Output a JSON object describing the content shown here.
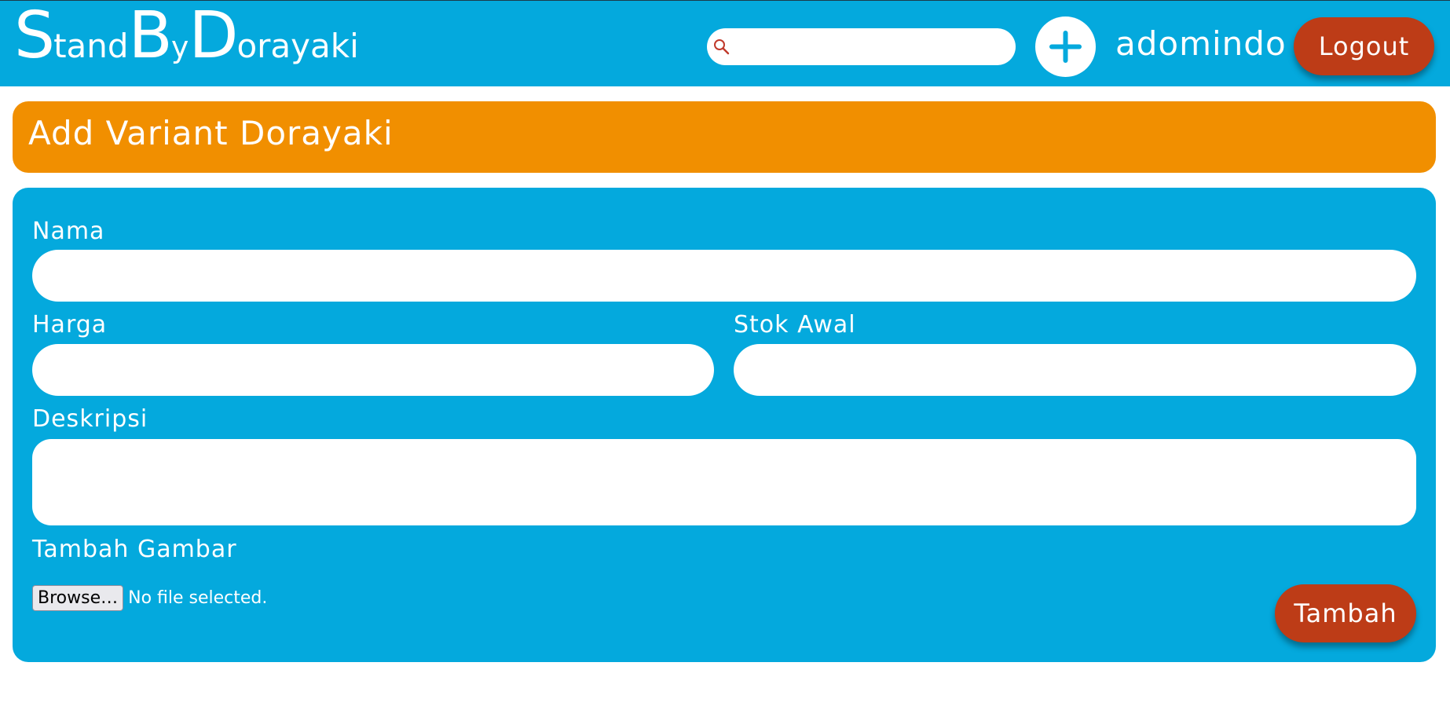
{
  "header": {
    "logo": {
      "s_cap": "S",
      "s_rest": "tand",
      "b_cap": "B",
      "b_rest": "y",
      "d_cap": "D",
      "d_rest": "orayaki"
    },
    "search": {
      "value": "",
      "placeholder": "",
      "icon": "magnifier-icon"
    },
    "add_button_icon": "plus-icon",
    "username": "adomindo",
    "logout_label": "Logout"
  },
  "page": {
    "title": "Add Variant Dorayaki"
  },
  "form": {
    "nama": {
      "label": "Nama",
      "value": ""
    },
    "harga": {
      "label": "Harga",
      "value": ""
    },
    "stok_awal": {
      "label": "Stok Awal",
      "value": ""
    },
    "deskripsi": {
      "label": "Deskripsi",
      "value": ""
    },
    "gambar": {
      "label": "Tambah Gambar",
      "browse_label": "Browse…",
      "status": "No file selected."
    },
    "submit_label": "Tambah"
  },
  "colors": {
    "primary_blue": "#04a9dd",
    "title_orange": "#f18f00",
    "button_red": "#bd3c17",
    "white": "#ffffff"
  }
}
